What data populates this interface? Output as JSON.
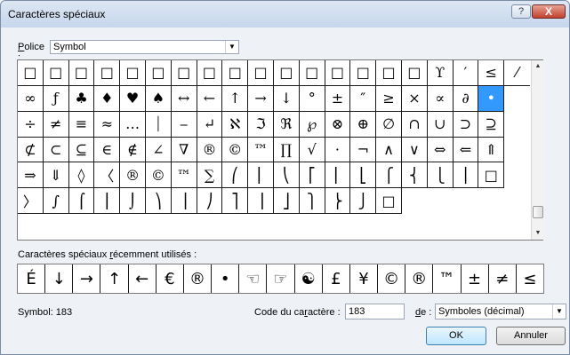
{
  "window": {
    "title": "Caractères spéciaux",
    "help_label": "?",
    "close_label": "X"
  },
  "font": {
    "label_accel": "P",
    "label_rest": "olice :",
    "value": "Symbol"
  },
  "grid": {
    "rows": [
      [
        "□",
        "□",
        "□",
        "□",
        "□",
        "□",
        "□",
        "□",
        "□",
        "□",
        "□",
        "□",
        "□",
        "□",
        "□",
        "□",
        "ϒ",
        "′",
        "≤",
        "⁄"
      ],
      [
        "∞",
        "ƒ",
        "♣",
        "♦",
        "♥",
        "♠",
        "↔",
        "←",
        "↑",
        "→",
        "↓",
        "°",
        "±",
        "″",
        "≥",
        "×",
        "∝",
        "∂",
        "•"
      ],
      [
        "÷",
        "≠",
        "≡",
        "≈",
        "…",
        "⏐",
        "⎯",
        "↵",
        "ℵ",
        "ℑ",
        "ℜ",
        "℘",
        "⊗",
        "⊕",
        "∅",
        "∩",
        "∪",
        "⊃",
        "⊇"
      ],
      [
        "⊄",
        "⊂",
        "⊆",
        "∈",
        "∉",
        "∠",
        "∇",
        "®",
        "©",
        "™",
        "∏",
        "√",
        "⋅",
        "¬",
        "∧",
        "∨",
        "⇔",
        "⇐",
        "⇑"
      ],
      [
        "⇒",
        "⇓",
        "◊",
        "〈",
        "®",
        "©",
        "™",
        "∑",
        "⎛",
        "⎜",
        "⎝",
        "⎡",
        "⎢",
        "⎣",
        "⎧",
        "⎨",
        "⎩",
        "⎪",
        "□"
      ],
      [
        "〉",
        "∫",
        "⌠",
        "⎮",
        "⌡",
        "⎞",
        "⎟",
        "⎠",
        "⎤",
        "⎥",
        "⎦",
        "⎫",
        "⎬",
        "⎭",
        "□"
      ]
    ],
    "selected_label": "Symbol: 183"
  },
  "recent": {
    "label_pre": "Caractères spéciaux ",
    "label_accel": "r",
    "label_post": "écemment utilisés :",
    "items": [
      "É",
      "↓",
      "→",
      "↑",
      "←",
      "€",
      "®",
      "•",
      "☜",
      "☞",
      "☯",
      "£",
      "¥",
      "©",
      "®",
      "™",
      "±",
      "≠",
      "≤"
    ]
  },
  "code": {
    "label_pre": "Code du ca",
    "label_accel": "r",
    "label_post": "actère :",
    "value": "183",
    "de_accel": "d",
    "de_rest": "e :",
    "de_value": "Symboles (décimal)"
  },
  "buttons": {
    "ok": "OK",
    "cancel": "Annuler"
  },
  "colors": {
    "selection": "#3399ff",
    "ok_border": "#3c7fb1",
    "close_red": "#c0412d"
  }
}
